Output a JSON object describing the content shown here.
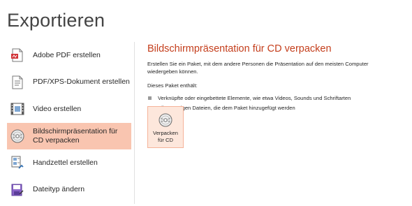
{
  "page": {
    "title": "Exportieren"
  },
  "nav": {
    "items": [
      {
        "label": "Adobe PDF erstellen",
        "icon": "pdf-document-icon",
        "selected": false
      },
      {
        "label": "PDF/XPS-Dokument erstellen",
        "icon": "xps-document-icon",
        "selected": false
      },
      {
        "label": "Video erstellen",
        "icon": "video-icon",
        "selected": false
      },
      {
        "label": "Bildschirmpräsentation für CD verpacken",
        "icon": "cd-package-icon",
        "selected": true
      },
      {
        "label": "Handzettel erstellen",
        "icon": "handout-icon",
        "selected": false
      },
      {
        "label": "Dateityp ändern",
        "icon": "change-file-type-icon",
        "selected": false
      }
    ]
  },
  "pane": {
    "title": "Bildschirmpräsentation für CD verpacken",
    "description": "Erstellen Sie ein Paket, mit dem andere Personen die Präsentation auf den meisten Computer wiedergeben können.",
    "subheading": "Dieses Paket enthält:",
    "bullets": [
      "Verknüpfte oder eingebettete Elemente, wie etwa Videos, Sounds und Schriftarten",
      "Alle sonstigen Dateien, die dem Paket hinzugefügt werden"
    ],
    "button": {
      "label": "Verpacken\nfür CD",
      "icon": "cd-icon"
    }
  },
  "colors": {
    "accent": "#c43e1c",
    "selected_bg": "#f9c5b0",
    "button_bg": "#fde7dc",
    "button_border": "#f5b39a"
  }
}
